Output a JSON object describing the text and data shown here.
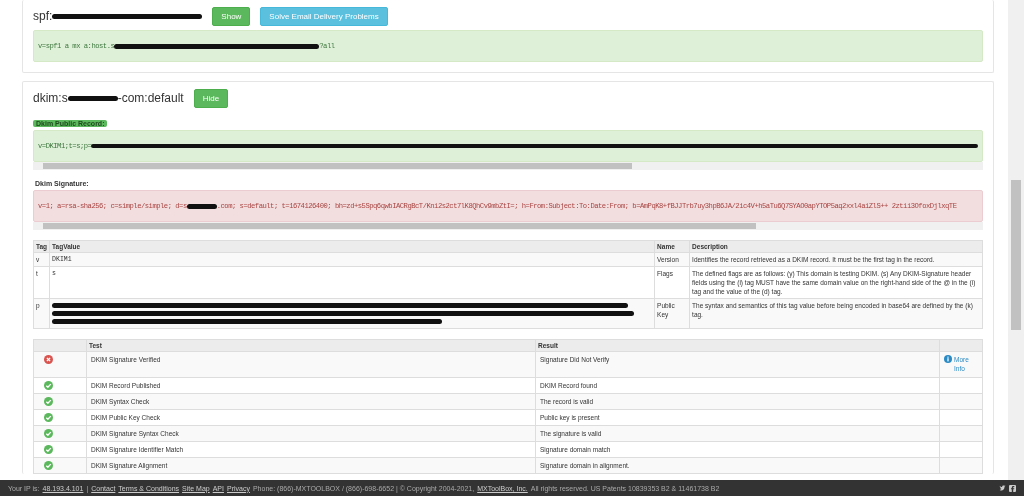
{
  "spf_record": {
    "title_prefix": "spf:",
    "show_button": "Show",
    "solve_button": "Solve Email Delivery Problems",
    "record_prefix": "v=spf1 a mx a:host.s",
    "record_suffix": " ?all"
  },
  "dkim_record": {
    "title_prefix": "dkim:s",
    "title_suffix": "-com:default",
    "hide_button": "Hide",
    "public_record_label": "Dkim Public Record:",
    "public_record_prefix": "v=DKIM1;t=s;p=",
    "signature_label": "Dkim Signature:",
    "signature_prefix": "v=1; a=rsa-sha256; c=simple/simple; d=s",
    "signature_suffix": ".com; s=default; t=1674126400; bh=zd+s5Spq6qwbIACRgBcT/Kni2s2ct7lK8QhCv9mbZtI=; h=From:Subject:To:Date:From; b=AmPqK8+fBJJTrb7uy3hpB6JA/2ic4V+h5aTu6Q7SYAO0apYTOP5aq2xxl4aiZlS++ 2ztii3OfoxDjlxqTE"
  },
  "tag_table": {
    "columns": [
      "Tag",
      "TagValue",
      "Name",
      "Description"
    ],
    "rows": [
      {
        "tag": "v",
        "value": "DKIM1",
        "name": "Version",
        "description": "Identifies the record retrieved as a DKIM record. It must be the first tag in the record."
      },
      {
        "tag": "t",
        "value": "s",
        "name": "Flags",
        "description": "The defined flags are as follows: (y) This domain is testing DKIM. (s) Any DKIM-Signature header fields using the (i) tag MUST have the same domain value on the right-hand side of the @ in the (i) tag and the value of the (d) tag."
      },
      {
        "tag": "p",
        "name": "Public Key",
        "description": "The syntax and semantics of this tag value before being encoded in base64 are defined by the (k) tag."
      }
    ]
  },
  "test_table": {
    "columns": [
      "Test",
      "Result"
    ],
    "rows": [
      {
        "passed": false,
        "test": "DKIM Signature Verified",
        "result": "Signature Did Not Verify",
        "more_info": "More Info"
      },
      {
        "passed": true,
        "test": "DKIM Record Published",
        "result": "DKIM Record found"
      },
      {
        "passed": true,
        "test": "DKIM Syntax Check",
        "result": "The record is valid"
      },
      {
        "passed": true,
        "test": "DKIM Public Key Check",
        "result": "Public key is present"
      },
      {
        "passed": true,
        "test": "DKIM Signature Syntax Check",
        "result": "The signature is valid"
      },
      {
        "passed": true,
        "test": "DKIM Signature Identifier Match",
        "result": "Signature domain match"
      },
      {
        "passed": true,
        "test": "DKIM Signature Alignment",
        "result": "Signature domain in alignment."
      }
    ]
  },
  "footer": {
    "items": [
      {
        "kind": "text",
        "text": "Your IP is:"
      },
      {
        "kind": "link",
        "text": "48.193.4.101"
      },
      {
        "kind": "text",
        "text": "|"
      },
      {
        "kind": "link",
        "text": "Contact"
      },
      {
        "kind": "link",
        "text": "Terms & Conditions"
      },
      {
        "kind": "link",
        "text": "Site Map"
      },
      {
        "kind": "link",
        "text": "API"
      },
      {
        "kind": "link",
        "text": "Privacy"
      },
      {
        "kind": "text",
        "text": "Phone: (866)-MXTOOLBOX / (866)-698-6652 | © Copyright 2004-2021,"
      },
      {
        "kind": "link",
        "text": "MXToolBox, Inc."
      },
      {
        "kind": "text",
        "text": "All rights reserved. US Patents 10839353 B2 & 11461738 B2"
      }
    ]
  }
}
